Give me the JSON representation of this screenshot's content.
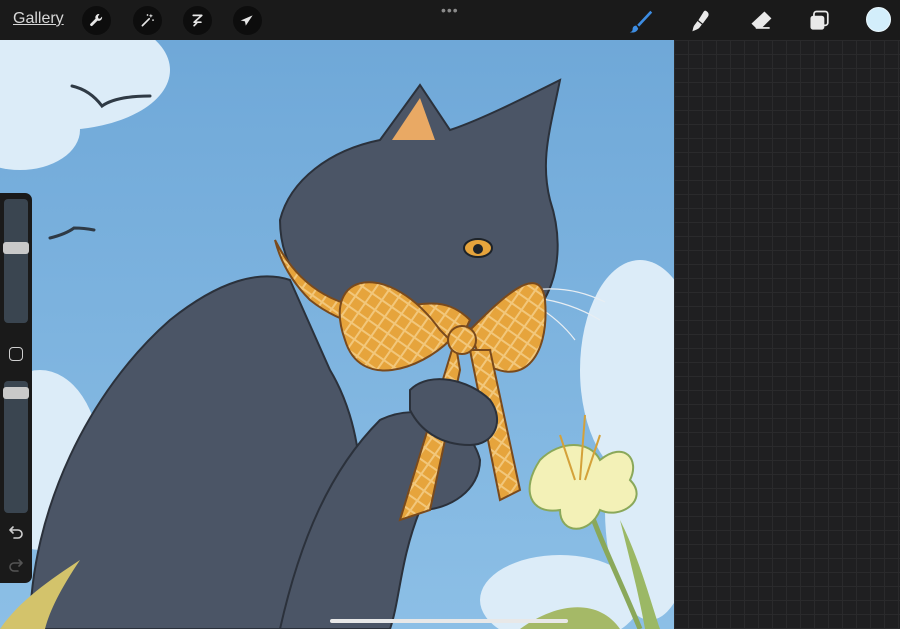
{
  "toolbar": {
    "gallery_label": "Gallery",
    "left_tools": [
      "wrench-icon",
      "magic-wand-icon",
      "selection-icon",
      "move-arrow-icon"
    ],
    "more_label": "•••",
    "right_tools": [
      "brush-icon",
      "smudge-icon",
      "eraser-icon",
      "layers-icon"
    ],
    "brush_active_color": "#3d8de3",
    "current_color": "#d3eefb"
  },
  "sidebar": {
    "brush_size_level": 0.62,
    "opacity_level": 0.95
  },
  "colors": {
    "sky": "#7fb3de",
    "cat_fur": "#4b5566",
    "ribbon": "#e6a43c",
    "flower": "#f3f1b7"
  }
}
